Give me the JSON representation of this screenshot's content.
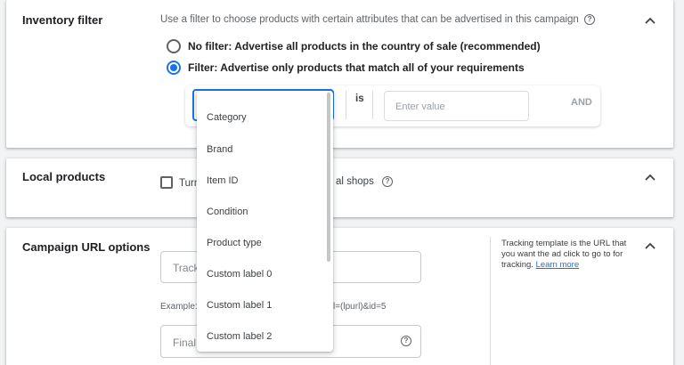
{
  "inventory_filter": {
    "title": "Inventory filter",
    "description": "Use a filter to choose products with certain attributes that can be advertised in this campaign",
    "option_no_filter": "No filter: Advertise all products in the country of sale (recommended)",
    "option_filter": "Filter: Advertise only products that match all of your requirements",
    "operator": "is",
    "value_placeholder": "Enter value",
    "and_label": "AND"
  },
  "dropdown": {
    "items": [
      "Category",
      "Brand",
      "Item ID",
      "Condition",
      "Product type",
      "Custom label 0",
      "Custom label 1",
      "Custom label 2"
    ]
  },
  "local_products": {
    "title": "Local products",
    "checkbox_label_start": "Turn",
    "checkbox_label_end": "al shops"
  },
  "campaign_url": {
    "title": "Campaign URL options",
    "tracking_placeholder": "Tracki",
    "example_prefix": "Example: I",
    "example_suffix": "l=(lpurl)&id=5",
    "final_url_placeholder": "Final U",
    "help_text": "Tracking template is the URL that you want the ad click to go to for tracking.",
    "learn_more": "Learn more"
  },
  "colors": {
    "accent": "#1a73e8",
    "background": "#f1f3f4"
  },
  "icons": [
    "chevron-up-icon",
    "help-icon",
    "radio-selected",
    "radio-unselected",
    "checkbox-unchecked"
  ]
}
